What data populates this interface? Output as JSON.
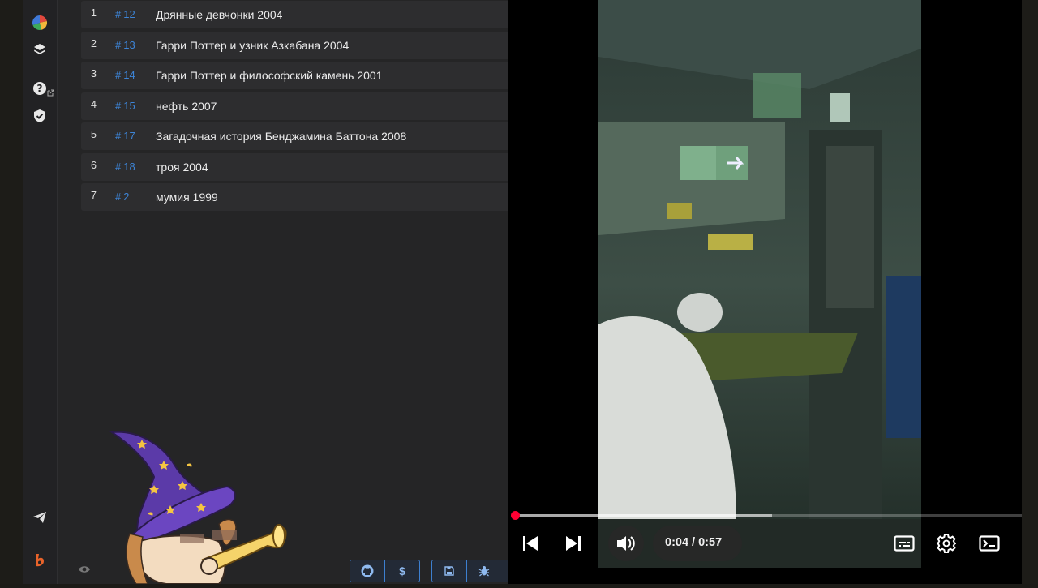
{
  "list": {
    "rows": [
      {
        "num": "1",
        "tag": "12",
        "title": "Дрянные девчонки 2004"
      },
      {
        "num": "2",
        "tag": "13",
        "title": "Гарри Поттер и узник Азкабана 2004"
      },
      {
        "num": "3",
        "tag": "14",
        "title": "Гарри Поттер и философский камень 2001"
      },
      {
        "num": "4",
        "tag": "15",
        "title": "нефть 2007"
      },
      {
        "num": "5",
        "tag": "17",
        "title": "Загадочная история Бенджамина Баттона 2008"
      },
      {
        "num": "6",
        "tag": "18",
        "title": "троя 2004"
      },
      {
        "num": "7",
        "tag": "2",
        "title": "мумия 1999"
      }
    ],
    "hash_symbol": "#"
  },
  "toolbar": {
    "dollar_label": "$"
  },
  "player": {
    "time": "0:04 / 0:57",
    "progress_played_fraction": 0.007,
    "progress_buffered_fraction": 0.51
  },
  "colors": {
    "accent": "#3d84d6",
    "progress": "#ff0033"
  },
  "icons": [
    "chart-pie-icon",
    "layers-icon",
    "help-icon",
    "shield-check-icon",
    "send-icon",
    "brand-icon",
    "eye-icon",
    "github-icon",
    "save-icon",
    "bug-icon",
    "skip-previous-icon",
    "skip-next-icon",
    "volume-icon",
    "subtitles-icon",
    "settings-icon",
    "miniplayer-icon"
  ]
}
